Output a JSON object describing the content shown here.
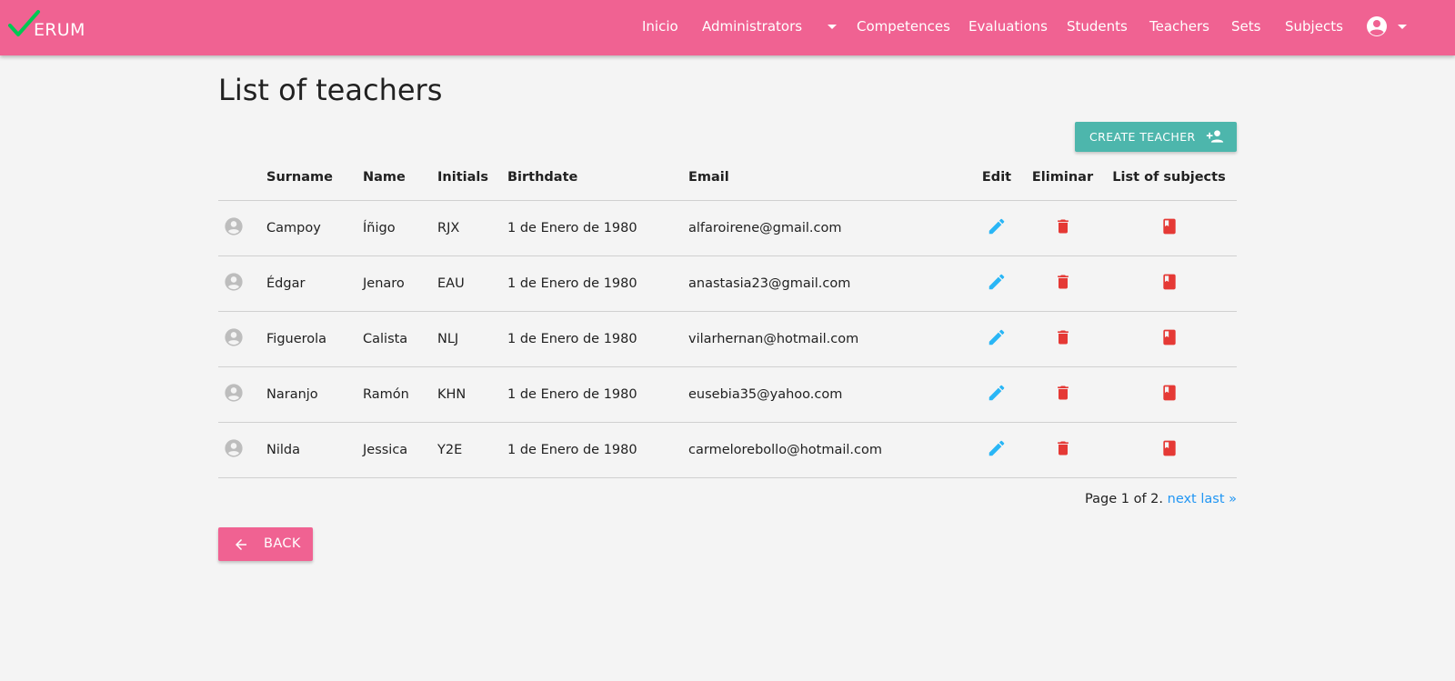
{
  "brand": {
    "name": "ERUM",
    "check_color": "#00c853"
  },
  "nav": {
    "items": [
      {
        "label": "Inicio"
      },
      {
        "label": "Administrators"
      },
      {
        "label": "Competences"
      },
      {
        "label": "Evaluations"
      },
      {
        "label": "Students"
      },
      {
        "label": "Teachers"
      },
      {
        "label": "Sets"
      },
      {
        "label": "Subjects"
      }
    ],
    "account_icon": "account-circle-icon",
    "color": "#f06292"
  },
  "page": {
    "title": "List of teachers",
    "create_button": {
      "label": "CREATE TEACHER",
      "icon": "person-add-icon",
      "color": "#4db6ac"
    }
  },
  "table": {
    "headers": {
      "surname": "Surname",
      "name": "Name",
      "initials": "Initials",
      "birthdate": "Birthdate",
      "email": "Email",
      "edit": "Edit",
      "delete": "Eliminar",
      "subjects": "List of subjects"
    },
    "rows": [
      {
        "surname": "Campoy",
        "name": "Íñigo",
        "initials": "RJX",
        "birthdate": "1 de Enero de 1980",
        "email": "alfaroirene@gmail.com"
      },
      {
        "surname": "Édgar",
        "name": "Jenaro",
        "initials": "EAU",
        "birthdate": "1 de Enero de 1980",
        "email": "anastasia23@gmail.com"
      },
      {
        "surname": "Figuerola",
        "name": "Calista",
        "initials": "NLJ",
        "birthdate": "1 de Enero de 1980",
        "email": "vilarhernan@hotmail.com"
      },
      {
        "surname": "Naranjo",
        "name": "Ramón",
        "initials": "KHN",
        "birthdate": "1 de Enero de 1980",
        "email": "eusebia35@yahoo.com"
      },
      {
        "surname": "Nilda",
        "name": "Jessica",
        "initials": "Y2E",
        "birthdate": "1 de Enero de 1980",
        "email": "carmelorebollo@hotmail.com"
      }
    ],
    "row_icons": {
      "avatar": "account-circle-icon",
      "edit": "pencil-icon",
      "delete": "trash-icon",
      "subjects": "book-icon"
    },
    "icon_colors": {
      "avatar": "#bdbdbd",
      "edit": "#29b6f6",
      "delete": "#e53935",
      "subjects": "#e53935"
    }
  },
  "pagination": {
    "text": "Page 1 of 2.",
    "next": "next",
    "last": "last »"
  },
  "back_button": {
    "label": "BACK",
    "icon": "arrow-left-icon"
  }
}
